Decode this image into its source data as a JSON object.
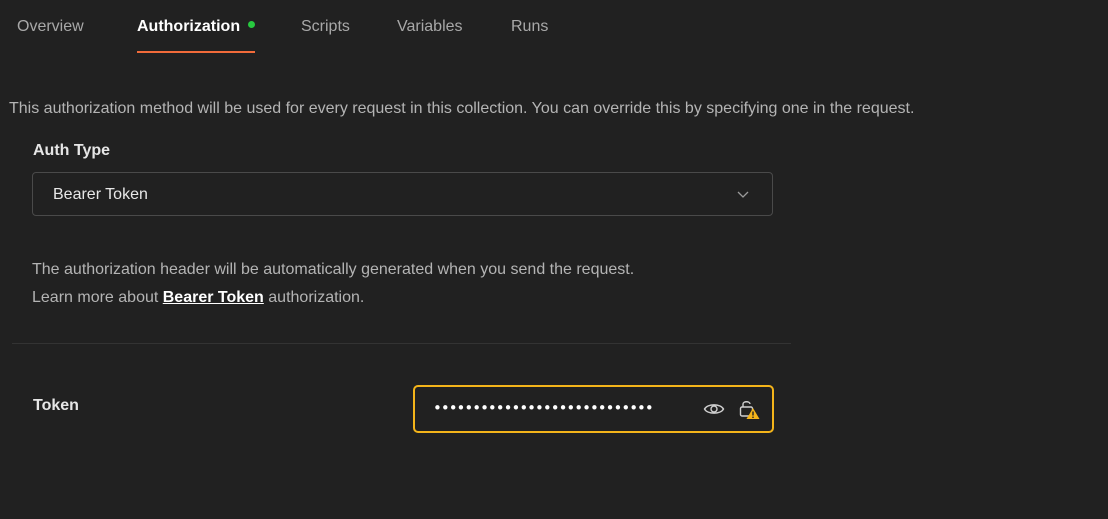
{
  "tabs": {
    "overview": "Overview",
    "authorization": "Authorization",
    "scripts": "Scripts",
    "variables": "Variables",
    "runs": "Runs"
  },
  "description": "This authorization method will be used for every request in this collection. You can override this by specifying one in the request.",
  "auth_type": {
    "label": "Auth Type",
    "selected": "Bearer Token"
  },
  "info": {
    "line1": "The authorization header will be automatically generated when you send the request.",
    "line2_prefix": "Learn more about ",
    "line2_link": "Bearer Token",
    "line2_suffix": " authorization."
  },
  "token": {
    "label": "Token",
    "masked_value": "••••••••••••••••••••••••••••"
  },
  "colors": {
    "accent": "#f26b3a",
    "status_dot": "#27c93f",
    "focus_border": "#f4b41a",
    "warning": "#f4b41a"
  }
}
